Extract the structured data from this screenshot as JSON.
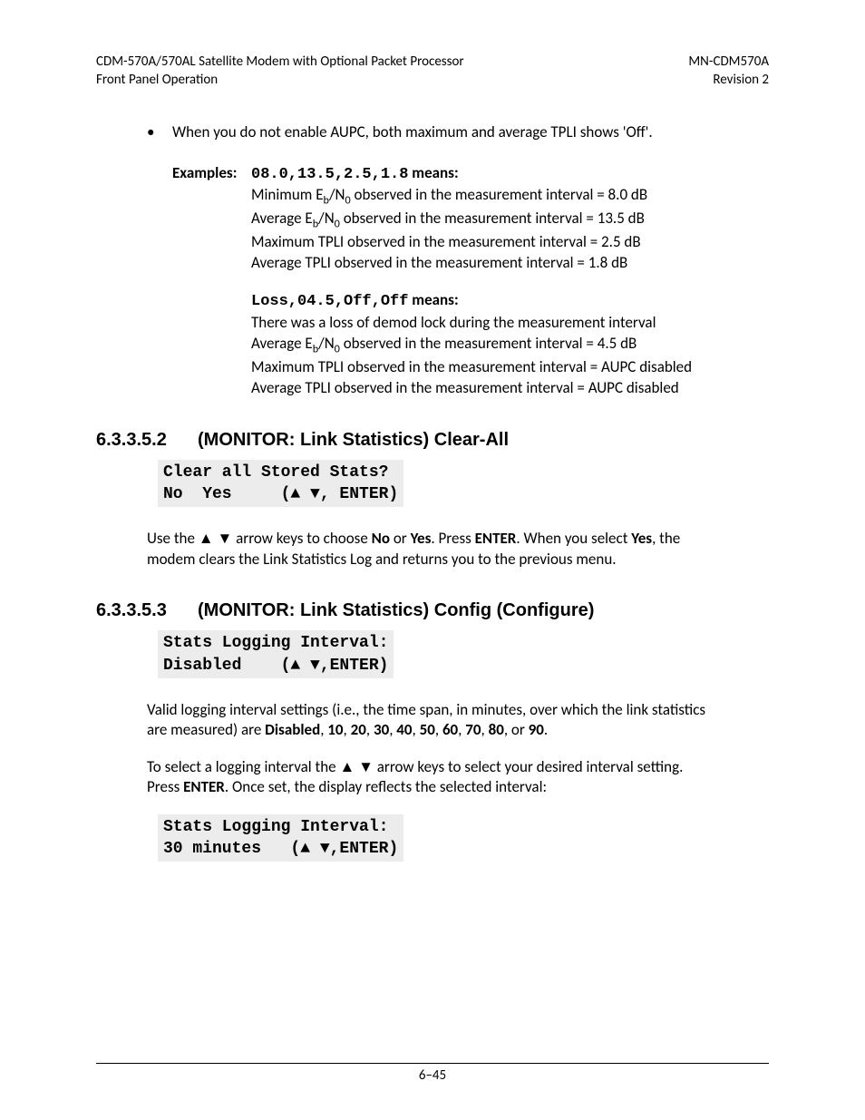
{
  "header": {
    "left_line1": "CDM-570A/570AL Satellite Modem with Optional Packet Processor",
    "left_line2": "Front Panel Operation",
    "right_line1": "MN-CDM570A",
    "right_line2": "Revision 2"
  },
  "bullet": "When you do not enable AUPC, both maximum and average TPLI shows 'Off'.",
  "examples_label": "Examples:",
  "example1": {
    "code": "08.0,13.5,2.5,1.8",
    "means": " means:",
    "lines": [
      "Minimum E_b/N_0 observed in the measurement interval = 8.0 dB",
      "Average E_b/N_0 observed in the measurement interval = 13.5 dB",
      "Maximum TPLI observed in the measurement interval = 2.5 dB",
      "Average TPLI observed in the measurement interval = 1.8 dB"
    ]
  },
  "example2": {
    "code": "Loss,04.5,Off,Off",
    "means": " means:",
    "lines": [
      "There was a loss of demod lock during the measurement interval",
      "Average E_b/N_0 observed in the measurement interval = 4.5 dB",
      "Maximum TPLI observed in the measurement interval = AUPC disabled",
      "Average TPLI observed in the measurement interval = AUPC disabled"
    ]
  },
  "section1": {
    "num": "6.3.3.5.2",
    "title": "(MONITOR: Link Statistics) Clear-All",
    "lcd": "Clear all Stored Stats?\nNo  Yes     (▲ ▼, ENTER)",
    "body_pre": "Use the ▲ ▼ arrow keys to choose ",
    "no": "No",
    "or": " or ",
    "yes": "Yes",
    "body_mid": ". Press ",
    "enter": "ENTER",
    "body_mid2": ". When you select ",
    "yes2": "Yes",
    "body_post": ", the modem clears the Link Statistics Log and returns you to the previous menu."
  },
  "section2": {
    "num": "6.3.3.5.3",
    "title": "(MONITOR: Link Statistics) Config (Configure)",
    "lcd1": "Stats Logging Interval:\nDisabled    (▲ ▼,ENTER)",
    "body1_pre": "Valid logging interval settings (i.e., the time span, in minutes, over which the link statistics are measured) are ",
    "opts": [
      "Disabled",
      "10",
      "20",
      "30",
      "40",
      "50",
      "60",
      "70",
      "80"
    ],
    "opts_or": ", or ",
    "opts_last": "90",
    "body1_post": ".",
    "body2_pre": "To select a logging interval the ▲ ▼ arrow keys to select your desired interval setting. Press ",
    "enter": "ENTER",
    "body2_post": ". Once set, the display reflects the selected interval:",
    "lcd2": "Stats Logging Interval:\n30 minutes   (▲ ▼,ENTER)"
  },
  "page_num": "6–45"
}
